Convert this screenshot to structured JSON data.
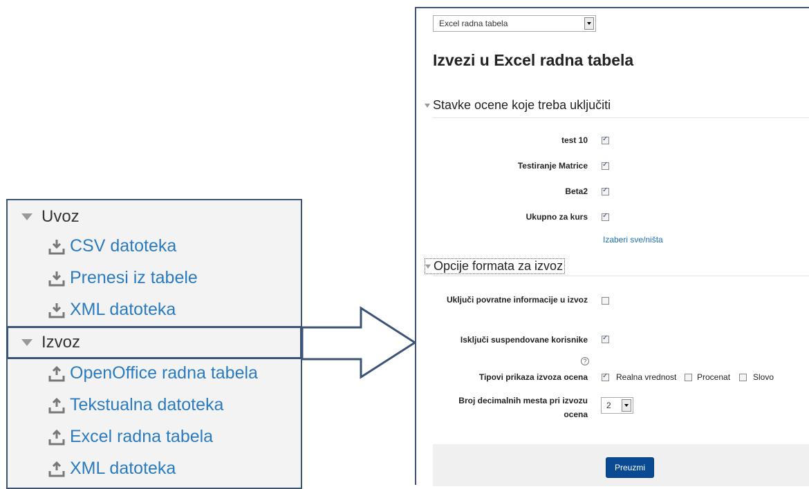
{
  "nav": {
    "import_header": "Uvoz",
    "import_items": [
      "CSV datoteka",
      "Prenesi iz tabele",
      "XML datoteka"
    ],
    "export_header": "Izvoz",
    "export_items": [
      "OpenOffice radna tabela",
      "Tekstualna datoteka",
      "Excel radna tabela",
      "XML datoteka"
    ]
  },
  "form": {
    "format_select": "Excel radna tabela",
    "heading": "Izvezi u Excel radna tabela",
    "section1": {
      "legend": "Stavke ocene koje treba uključiti",
      "items": [
        {
          "label": "test 10",
          "checked": true
        },
        {
          "label": "Testiranje Matrice",
          "checked": true
        },
        {
          "label": "Beta2",
          "checked": true
        },
        {
          "label": "Ukupno za kurs",
          "checked": true
        }
      ],
      "select_all_link": "Izaberi sve/ništa"
    },
    "section2": {
      "legend": "Opcije formata za izvoz",
      "include_feedback_label": "Uključi povratne informacije u izvoz",
      "include_feedback_checked": false,
      "exclude_suspended_label": "Isključi suspendovane korisnike",
      "exclude_suspended_checked": true,
      "display_types_label": "Tipovi prikaza izvoza ocena",
      "display_types": [
        {
          "label": "Realna vrednost",
          "checked": true
        },
        {
          "label": "Procenat",
          "checked": false
        },
        {
          "label": "Slovo",
          "checked": false
        }
      ],
      "decimals_label": "Broj decimalnih mesta pri izvozu ocena",
      "decimals_value": "2"
    },
    "download_button": "Preuzmi"
  },
  "colors": {
    "link": "#2a7bbf",
    "frame": "#3b5375",
    "button": "#0a4a92"
  }
}
